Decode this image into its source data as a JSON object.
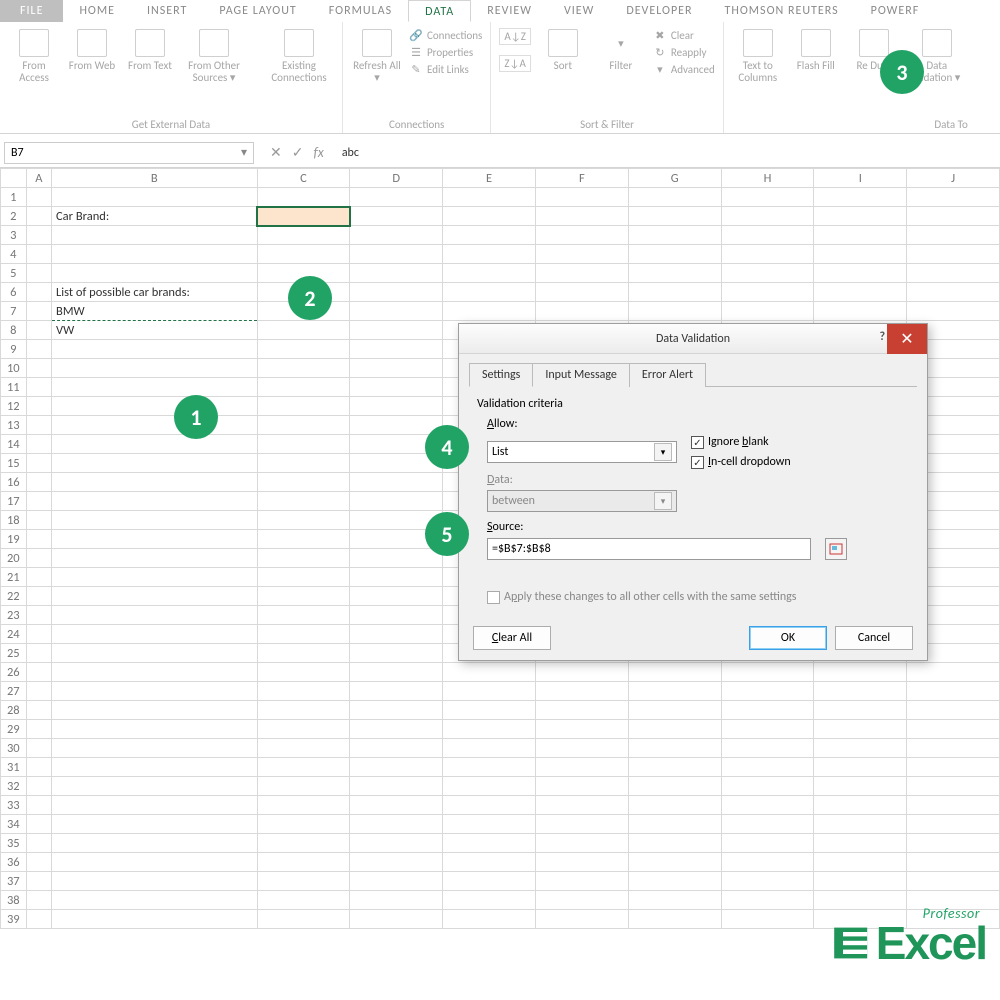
{
  "tabs": {
    "file": "FILE",
    "home": "HOME",
    "insert": "INSERT",
    "pagelayout": "PAGE LAYOUT",
    "formulas": "FORMULAS",
    "data": "DATA",
    "review": "REVIEW",
    "view": "VIEW",
    "developer": "DEVELOPER",
    "tr": "THOMSON REUTERS",
    "power": "POWERF"
  },
  "ribbon": {
    "ext": {
      "access": "From Access",
      "web": "From Web",
      "text": "From Text",
      "other": "From Other Sources ▾",
      "existing": "Existing Connections",
      "title": "Get External Data"
    },
    "conn": {
      "refresh": "Refresh All ▾",
      "connections": "Connections",
      "properties": "Properties",
      "editlinks": "Edit Links",
      "title": "Connections"
    },
    "sort": {
      "sort": "Sort",
      "filter": "Filter",
      "clear": "Clear",
      "reapply": "Reapply",
      "advanced": "Advanced",
      "title": "Sort & Filter"
    },
    "tools": {
      "ttc": "Text to Columns",
      "flash": "Flash Fill",
      "remdup": "Re\nDupl",
      "datavalid": "Data alidation ▾",
      "title": "Data To"
    }
  },
  "namebox": "B7",
  "formula": "abc",
  "columns": [
    "",
    "A",
    "B",
    "C",
    "D",
    "E",
    "F",
    "G",
    "H",
    "I",
    "J"
  ],
  "cells": {
    "B2": "Car Brand:",
    "B6": "List of possible car brands:",
    "B7": "BMW",
    "B8": "VW"
  },
  "dialog": {
    "title": "Data Validation",
    "tabs": [
      "Settings",
      "Input Message",
      "Error Alert"
    ],
    "criteria": "Validation criteria",
    "allow_label": "Allow:",
    "allow_value": "List",
    "data_label": "Data:",
    "data_value": "between",
    "source_label": "Source:",
    "source_value": "=$B$7:$B$8",
    "ignore_blank": "Ignore blank",
    "incell": "In-cell dropdown",
    "apply_all": "Apply these changes to all other cells with the same settings",
    "clear": "Clear All",
    "ok": "OK",
    "cancel": "Cancel"
  },
  "badges": {
    "1": "1",
    "2": "2",
    "3": "3",
    "4": "4",
    "5": "5"
  },
  "watermark": {
    "prof": "Professor",
    "excel": "Excel"
  }
}
